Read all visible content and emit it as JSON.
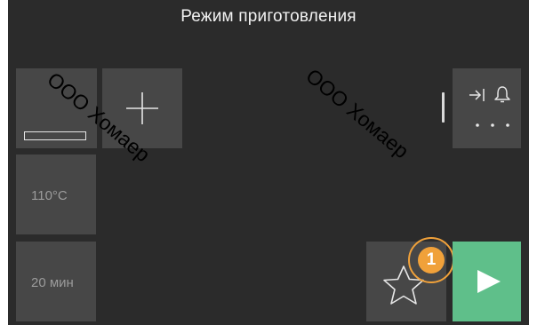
{
  "header": {
    "title": "Режим приготовления"
  },
  "tiles": {
    "temperature": "110°C",
    "time": "20 мин"
  },
  "favorites": {
    "badge_count": "1"
  },
  "watermark": {
    "text": "ООО Хомаер"
  },
  "colors": {
    "background": "#2b2b2b",
    "tile": "#474747",
    "start_button": "#5fbf8a",
    "badge": "#f0a13a"
  },
  "icons": [
    "mode-icon",
    "plus-icon",
    "skip-to-end-icon",
    "bell-icon",
    "more-dots-icon",
    "star-icon",
    "play-icon"
  ]
}
